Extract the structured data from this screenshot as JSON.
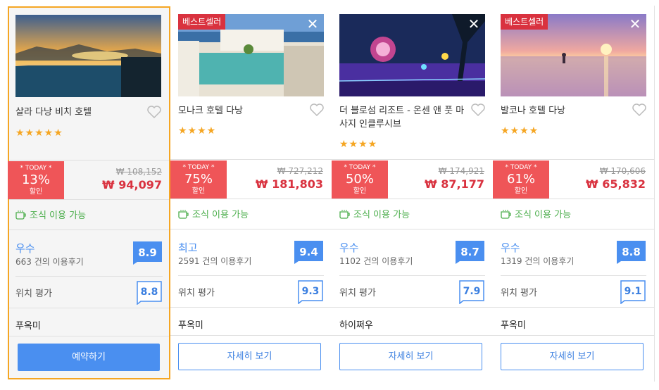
{
  "hotels": [
    {
      "name": "살라 다낭 비치 호텔",
      "best_label": "",
      "stars": "★★★★★",
      "today_label": "* TODAY *",
      "discount": "13%",
      "discount_label": "할인",
      "original_price": "₩ 108,152",
      "sale_price": "₩ 94,097",
      "breakfast": "조식 이용 가능",
      "rating_label": "우수",
      "review_count": "663 건의 이용후기",
      "rating_score": "8.9",
      "location_label": "위치 평가",
      "location_score": "8.8",
      "area": "푸옥미",
      "button_label": "예약하기"
    },
    {
      "name": "모나크 호텔 다낭",
      "best_label": "베스트셀러",
      "stars": "★★★★",
      "today_label": "* TODAY *",
      "discount": "75%",
      "discount_label": "할인",
      "original_price": "₩ 727,212",
      "sale_price": "₩ 181,803",
      "breakfast": "조식 이용 가능",
      "rating_label": "최고",
      "review_count": "2591 건의 이용후기",
      "rating_score": "9.4",
      "location_label": "위치 평가",
      "location_score": "9.3",
      "area": "푸옥미",
      "button_label": "자세히 보기"
    },
    {
      "name": "더 블로섬 리조트 - 온센 앤 풋 마사지 인클루시브",
      "best_label": "",
      "stars": "★★★★",
      "today_label": "* TODAY *",
      "discount": "50%",
      "discount_label": "할인",
      "original_price": "₩ 174,921",
      "sale_price": "₩ 87,177",
      "breakfast": "조식 이용 가능",
      "rating_label": "우수",
      "review_count": "1102 건의 이용후기",
      "rating_score": "8.7",
      "location_label": "위치 평가",
      "location_score": "7.9",
      "area": "하이쩌우",
      "button_label": "자세히 보기"
    },
    {
      "name": "발코나 호텔 다낭",
      "best_label": "베스트셀러",
      "stars": "★★★★",
      "today_label": "* TODAY *",
      "discount": "61%",
      "discount_label": "할인",
      "original_price": "₩ 170,606",
      "sale_price": "₩ 65,832",
      "breakfast": "조식 이용 가능",
      "rating_label": "우수",
      "review_count": "1319 건의 이용후기",
      "rating_score": "8.8",
      "location_label": "위치 평가",
      "location_score": "9.1",
      "area": "푸옥미",
      "button_label": "자세히 보기"
    }
  ],
  "icons": {
    "close": "close-icon",
    "heart": "heart-icon",
    "breakfast": "coffee-cup-icon",
    "rating_badge": "speech-bubble-icon"
  },
  "colors": {
    "accent_blue": "#4a8ff0",
    "discount_red": "#ef5558",
    "price_red": "#d9323f",
    "star_orange": "#f5a623",
    "breakfast_green": "#4cae4c",
    "selected_border": "#f5a623"
  }
}
